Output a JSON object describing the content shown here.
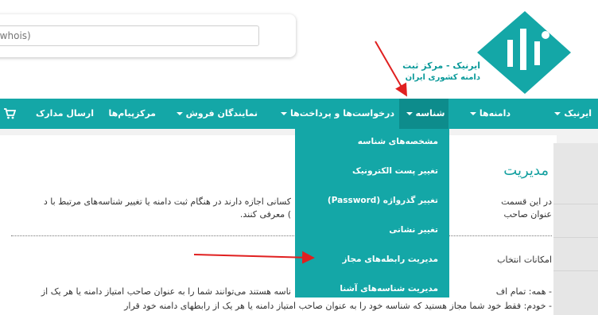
{
  "search": {
    "placeholder": "(whois)"
  },
  "logo": {
    "line1": "ایرنیک - مرکز ثبت",
    "line2": "دامنه کشوری ایران"
  },
  "nav": {
    "items": [
      {
        "label": "ایرنیک",
        "dropdown": true
      },
      {
        "label": "دامنه‌ها",
        "dropdown": true
      },
      {
        "label": "شناسه",
        "dropdown": true,
        "active": true
      },
      {
        "label": "درخواست‌ها و پرداخت‌ها",
        "dropdown": true
      },
      {
        "label": "نمایندگان فروش",
        "dropdown": true
      },
      {
        "label": "مرکزپیام‌ها",
        "dropdown": false
      },
      {
        "label": "ارسال مدارک",
        "dropdown": false
      }
    ],
    "cart_icon": "cart-icon"
  },
  "dropdown": {
    "items": [
      "مشخصه‌های شناسه",
      "تغییر پست الکترونیک",
      "تغییر گذرواژه (Password)",
      "تغییر نشانی",
      "مدیریت رابطه‌های مجاز",
      "مدیریت شناسه‌های آشنا"
    ]
  },
  "content": {
    "heading": "مدیریت",
    "p1_right": "در این قسمت",
    "p1_left": "کسانی اجازه دارند در هنگام ثبت دامنه یا تغییر شناسه‌های مرتبط با د",
    "p2_right": "عنوان صاحب",
    "p2_left": ") معرفی کنند.",
    "section": "امکانات انتخاب",
    "b1_right": "- همه: تمام اف",
    "b1_left": "ناسه هستند می‌توانند شما را به عنوان صاحب امتیاز دامنه یا هر یک از",
    "b2": "- خودم: فقط خود شما مجاز هستید که شناسه خود را به عنوان صاحب امتیاز دامنه یا هر یک از رابطهای دامنه خود قرار"
  },
  "colors": {
    "accent": "#14a7a7",
    "accent_dark": "#0d8c8c",
    "annotation": "#e02020"
  }
}
